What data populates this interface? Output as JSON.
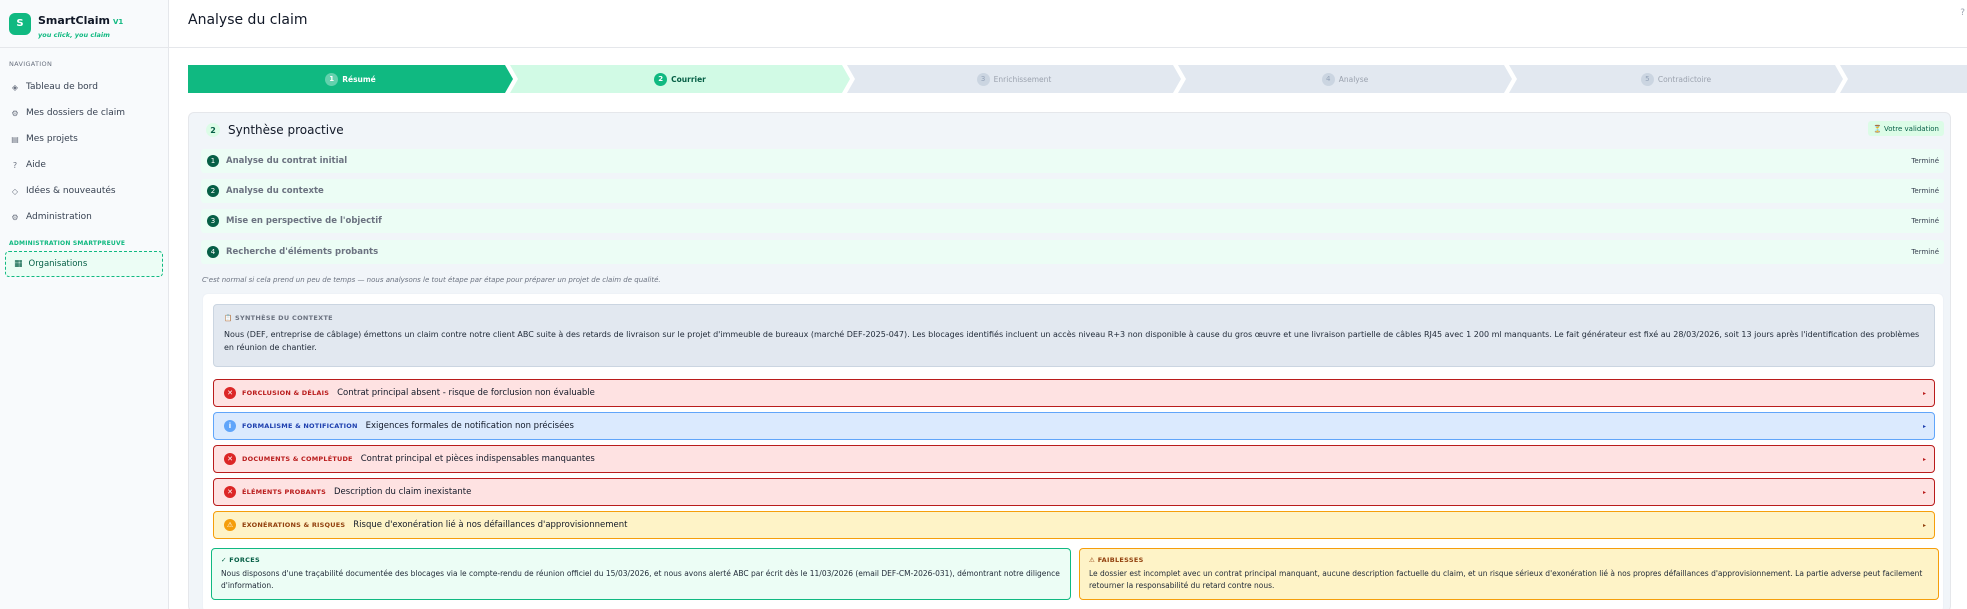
{
  "brand": {
    "initial": "S",
    "name": "SmartClaim",
    "version": "V1",
    "tagline": "you click, you claim"
  },
  "nav": {
    "title": "NAVIGATION",
    "items": [
      {
        "label": "Tableau de bord",
        "icon": "◈"
      },
      {
        "label": "Mes dossiers de claim",
        "icon": "⚙"
      },
      {
        "label": "Mes projets",
        "icon": "▤"
      },
      {
        "label": "Aide",
        "icon": "?"
      },
      {
        "label": "Idées & nouveautés",
        "icon": "◇"
      },
      {
        "label": "Administration",
        "icon": "⚙"
      }
    ]
  },
  "admin": {
    "title": "ADMINISTRATION SMARTPREUVE",
    "org_label": "Organisations",
    "org_icon": "▦"
  },
  "header": {
    "title": "Analyse du claim",
    "corner": "?"
  },
  "stepper": [
    {
      "num": "1",
      "label": "Résumé"
    },
    {
      "num": "2",
      "label": "Courrier"
    },
    {
      "num": "3",
      "label": "Enrichissement"
    },
    {
      "num": "4",
      "label": "Analyse"
    },
    {
      "num": "5",
      "label": "Contradictoire"
    }
  ],
  "synthese": {
    "badge": "2",
    "title": "Synthèse proactive",
    "validation": "⏳ Votre validation",
    "tasks": [
      {
        "num": "1",
        "label": "Analyse du contrat initial",
        "status": "Terminé"
      },
      {
        "num": "2",
        "label": "Analyse du contexte",
        "status": "Terminé"
      },
      {
        "num": "3",
        "label": "Mise en perspective de l'objectif",
        "status": "Terminé"
      },
      {
        "num": "4",
        "label": "Recherche d'éléments probants",
        "status": "Terminé"
      }
    ],
    "note": "C'est normal si cela prend un peu de temps — nous analysons le tout étape par étape pour préparer un projet de claim de qualité."
  },
  "context": {
    "title": "📋 SYNTHÈSE DU CONTEXTE",
    "text": "Nous (DEF, entreprise de câblage) émettons un claim contre notre client ABC suite à des retards de livraison sur le projet d'immeuble de bureaux (marché DEF-2025-047). Les blocages identifiés incluent un accès niveau R+3 non disponible à cause du gros œuvre et une livraison partielle de câbles RJ45 avec 1 200 ml manquants. Le fait générateur est fixé au 28/03/2026, soit 13 jours après l'identification des problèmes en réunion de chantier."
  },
  "risks": [
    {
      "icon": "✕",
      "category": "FORCLUSION & DÉLAIS",
      "title": "Contrat principal absent - risque de forclusion non évaluable"
    },
    {
      "icon": "i",
      "category": "FORMALISME & NOTIFICATION",
      "title": "Exigences formales de notification non précisées"
    },
    {
      "icon": "✕",
      "category": "DOCUMENTS & COMPLÉTUDE",
      "title": "Contrat principal et pièces indispensables manquantes"
    },
    {
      "icon": "✕",
      "category": "ÉLÉMENTS PROBANTS",
      "title": "Description du claim inexistante"
    },
    {
      "icon": "⚠",
      "category": "EXONÉRATIONS & RISQUES",
      "title": "Risque d'exonération lié à nos défaillances d'approvisionnement"
    }
  ],
  "chevron": "▸",
  "strengths": {
    "title": "✓ FORCES",
    "text": "Nous disposons d'une traçabilité documentée des blocages via le compte-rendu de réunion officiel du 15/03/2026, et nous avons alerté ABC par écrit dès le 11/03/2026 (email DEF-CM-2026-031), démontrant notre diligence d'information."
  },
  "weaknesses": {
    "title": "⚠ FAIBLESSES",
    "text": "Le dossier est incomplet avec un contrat principal manquant, aucune description factuelle du claim, et un risque sérieux d'exonération lié à nos propres défaillances d'approvisionnement. La partie adverse peut facilement retourner la responsabilité du retard contre nous."
  }
}
